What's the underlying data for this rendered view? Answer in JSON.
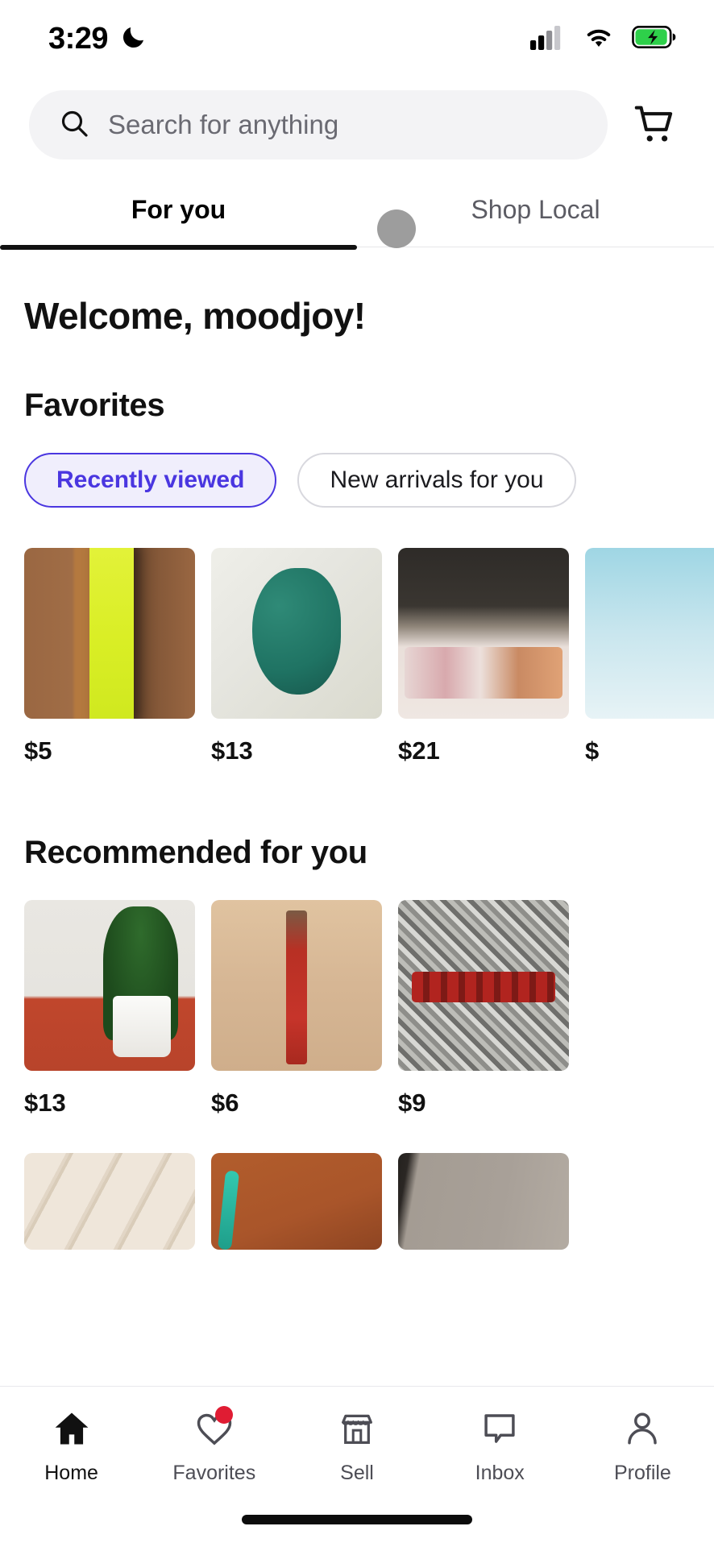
{
  "status_bar": {
    "time": "3:29",
    "dnd_icon": "crescent-moon-icon",
    "signal_icon": "cellular-signal-icon",
    "wifi_icon": "wifi-icon",
    "battery_icon": "battery-charging-icon"
  },
  "header": {
    "search_placeholder": "Search for anything",
    "search_icon": "search-icon",
    "cart_icon": "shopping-cart-icon"
  },
  "tabs": [
    {
      "label": "For you",
      "active": true
    },
    {
      "label": "Shop Local",
      "active": false
    }
  ],
  "main": {
    "welcome": "Welcome, moodjoy!",
    "favorites": {
      "title": "Favorites",
      "chips": [
        {
          "label": "Recently viewed",
          "selected": true
        },
        {
          "label": "New arrivals for you",
          "selected": false
        }
      ],
      "items": [
        {
          "price": "$5",
          "image": "yellow-collar-on-wood"
        },
        {
          "price": "$13",
          "image": "teal-leopard-harness-in-bag"
        },
        {
          "price": "$21",
          "image": "floral-rose-collar-rose-gold-buckle"
        },
        {
          "price": "$",
          "image": "blue-item-partial"
        }
      ]
    },
    "recommended": {
      "title": "Recommended for you",
      "items": [
        {
          "price": "$13",
          "image": "camo-collar-with-plant"
        },
        {
          "price": "$6",
          "image": "red-collar-with-tag"
        },
        {
          "price": "$9",
          "image": "red-plaid-collar-on-granite"
        }
      ],
      "items_partial": [
        {
          "image": "wood-background-green-script"
        },
        {
          "image": "brown-leather-teal-item"
        },
        {
          "image": "gray-neutral-product"
        }
      ]
    }
  },
  "bottom_nav": [
    {
      "label": "Home",
      "icon": "home-icon",
      "active": true,
      "badge": false
    },
    {
      "label": "Favorites",
      "icon": "heart-icon",
      "active": false,
      "badge": true
    },
    {
      "label": "Sell",
      "icon": "store-icon",
      "active": false,
      "badge": false
    },
    {
      "label": "Inbox",
      "icon": "message-icon",
      "active": false,
      "badge": false
    },
    {
      "label": "Profile",
      "icon": "person-icon",
      "active": false,
      "badge": false
    }
  ],
  "colors": {
    "accent": "#4a36e0",
    "chip_selected_bg": "#f0eefc",
    "badge": "#e01c33",
    "search_bg": "#f3f3f5",
    "text_primary": "#111111",
    "text_secondary": "#5c5c64"
  }
}
